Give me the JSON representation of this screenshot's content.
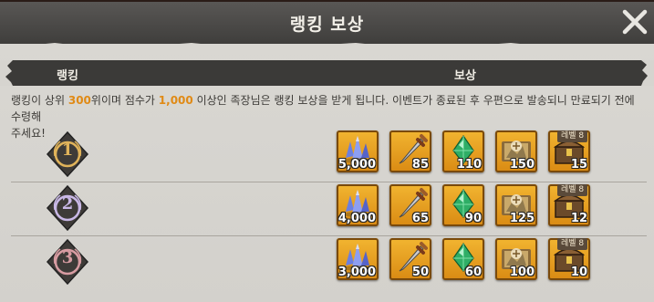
{
  "dialog": {
    "title": "랭킹 보상"
  },
  "columns": {
    "rank": "랭킹",
    "reward": "보상"
  },
  "notice": {
    "p1": "랭킹이 상위 ",
    "rank_limit": "300",
    "p2": "위이며 점수가 ",
    "score_min": "1,000",
    "p3": " 이상인 족장님은 랭킹 보상을 받게 됩니다. 이벤트가 종료된 후 우편으로 발송되니 만료되기 전에 수령해",
    "p4": "주세요!"
  },
  "colors": {
    "highlight": "#e08a15",
    "gold_medal": "#e0b35a",
    "silver_medal": "#c9b8e6",
    "bronze_medal": "#d89ca2"
  },
  "rewards": [
    {
      "rank": "1",
      "medal": "gold",
      "items": [
        {
          "icon": "crystal-icon",
          "qty": "5,000"
        },
        {
          "icon": "dagger-icon",
          "qty": "85"
        },
        {
          "icon": "green-gem-icon",
          "qty": "110"
        },
        {
          "icon": "map-scroll-icon",
          "qty": "150"
        },
        {
          "icon": "treasure-chest-icon",
          "badge": "레벨 8",
          "qty": "15"
        }
      ]
    },
    {
      "rank": "2",
      "medal": "silver",
      "items": [
        {
          "icon": "crystal-icon",
          "qty": "4,000"
        },
        {
          "icon": "dagger-icon",
          "qty": "65"
        },
        {
          "icon": "green-gem-icon",
          "qty": "90"
        },
        {
          "icon": "map-scroll-icon",
          "qty": "125"
        },
        {
          "icon": "treasure-chest-icon",
          "badge": "레벨 8",
          "qty": "12"
        }
      ]
    },
    {
      "rank": "3",
      "medal": "bronze",
      "items": [
        {
          "icon": "crystal-icon",
          "qty": "3,000"
        },
        {
          "icon": "dagger-icon",
          "qty": "50"
        },
        {
          "icon": "green-gem-icon",
          "qty": "60"
        },
        {
          "icon": "map-scroll-icon",
          "qty": "100"
        },
        {
          "icon": "treasure-chest-icon",
          "badge": "레벨 8",
          "qty": "10"
        }
      ]
    }
  ]
}
